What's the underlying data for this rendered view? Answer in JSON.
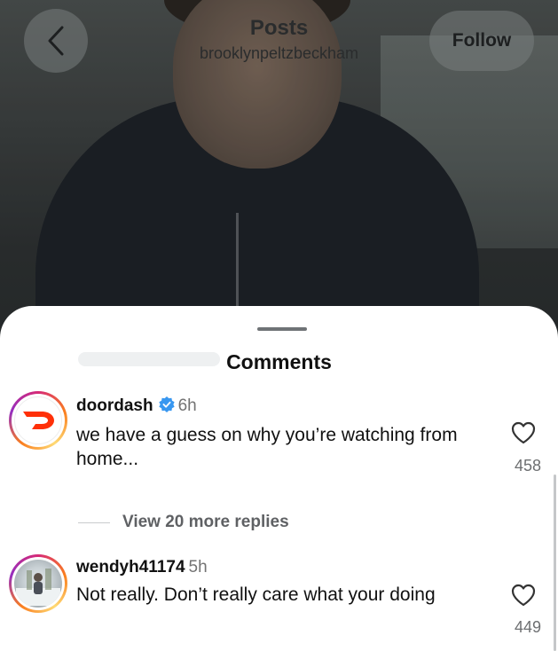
{
  "header": {
    "title": "Posts",
    "subtitle": "brooklynpeltzbeckham",
    "follow_label": "Follow"
  },
  "sheet": {
    "title": "Comments"
  },
  "comments": [
    {
      "username": "doordash",
      "verified": true,
      "time": "6h",
      "text": "we have a guess on why you’re watching from home...",
      "likes": "458"
    },
    {
      "username": "wendyh41174",
      "verified": false,
      "time": "5h",
      "text": "Not really. Don’t really care what your doing",
      "likes": "449"
    }
  ],
  "replies": {
    "label": "View 20 more replies"
  },
  "colors": {
    "doordash_red": "#ff3008",
    "verified_blue": "#3897f0",
    "muted_text": "#737373"
  }
}
